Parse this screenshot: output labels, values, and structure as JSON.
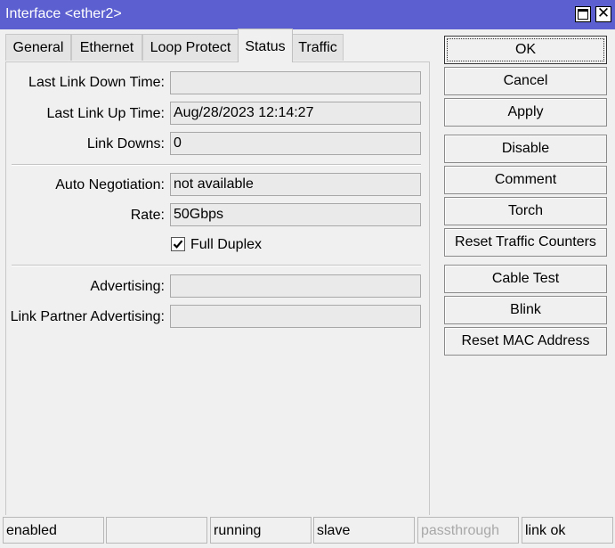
{
  "window": {
    "title": "Interface <ether2>"
  },
  "tabs": [
    {
      "label": "General"
    },
    {
      "label": "Ethernet"
    },
    {
      "label": "Loop Protect"
    },
    {
      "label": "Status",
      "active": true
    },
    {
      "label": "Traffic"
    }
  ],
  "status_tab": {
    "last_link_down_time": {
      "label": "Last Link Down Time:",
      "value": ""
    },
    "last_link_up_time": {
      "label": "Last Link Up Time:",
      "value": "Aug/28/2023 12:14:27"
    },
    "link_downs": {
      "label": "Link Downs:",
      "value": "0"
    },
    "auto_negotiation": {
      "label": "Auto Negotiation:",
      "value": "not available"
    },
    "rate": {
      "label": "Rate:",
      "value": "50Gbps"
    },
    "full_duplex": {
      "label": "Full Duplex",
      "checked": true
    },
    "advertising": {
      "label": "Advertising:",
      "value": ""
    },
    "link_partner_advertising": {
      "label": "Link Partner Advertising:",
      "value": ""
    }
  },
  "buttons": {
    "ok": "OK",
    "cancel": "Cancel",
    "apply": "Apply",
    "disable": "Disable",
    "comment": "Comment",
    "torch": "Torch",
    "reset_traffic_counters": "Reset Traffic Counters",
    "cable_test": "Cable Test",
    "blink": "Blink",
    "reset_mac_address": "Reset MAC Address"
  },
  "statusbar": {
    "cells": [
      "enabled",
      "",
      "running",
      "slave",
      "passthrough",
      "link ok"
    ]
  },
  "colors": {
    "titlebar": "#5b5fcf",
    "window_bg": "#f0f0f0",
    "disabled_text": "#a8a8a8"
  }
}
